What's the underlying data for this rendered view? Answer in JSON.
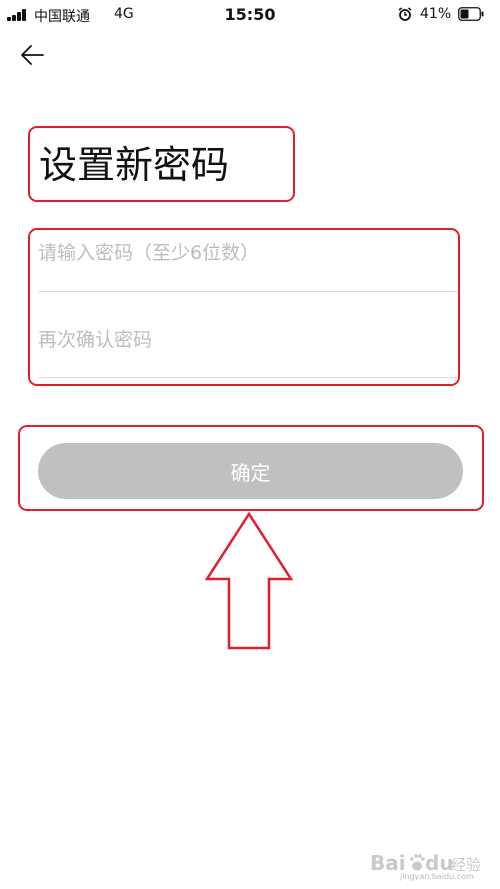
{
  "status_bar": {
    "carrier": "中国联通",
    "network": "4G",
    "time": "15:50",
    "battery_percent": "41%"
  },
  "header": {
    "back_icon": "back-arrow-icon"
  },
  "page": {
    "title": "设置新密码"
  },
  "form": {
    "password_placeholder": "请输入密码（至少6位数）",
    "confirm_placeholder": "再次确认密码",
    "confirm_label": "确定",
    "button_color": "#c0c0c0"
  },
  "annotations": {
    "highlight_color": "#e21e2e"
  },
  "watermark": {
    "brand": "Bai du 经验",
    "site": "jingyan.baidu.com"
  }
}
